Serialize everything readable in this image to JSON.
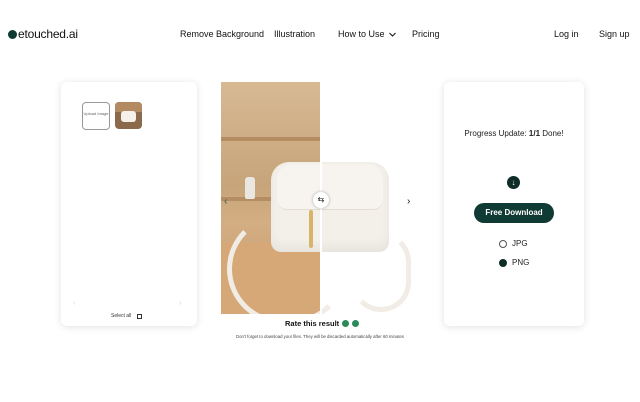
{
  "header": {
    "logo_text": "etouched.ai",
    "nav": [
      "Remove Background",
      "Illustration",
      "How to Use",
      "Pricing"
    ],
    "login": "Log in",
    "signup": "Sign up"
  },
  "left_panel": {
    "upload_label": "Upload Image",
    "select_all": "Select all"
  },
  "result": {
    "rate_label": "Rate this result",
    "notice": "Don't forget to download your files. They will be discarded automatically after 60 minutes"
  },
  "right_panel": {
    "progress_prefix": "Progress Update:",
    "progress_count": "1/1",
    "progress_suffix": "Done!",
    "download_button": "Free Download",
    "formats": [
      {
        "label": "JPG",
        "selected": false
      },
      {
        "label": "PNG",
        "selected": true
      }
    ]
  },
  "colors": {
    "accent": "#103a34",
    "rate_green": "#2b8a5a"
  },
  "icons": [
    "logo-mark-icon",
    "chevron-down-icon",
    "compare-arrows-icon",
    "chevron-left-icon",
    "chevron-right-icon",
    "download-icon",
    "thumbs-up-icon",
    "thumbs-down-icon",
    "checkbox-icon"
  ]
}
